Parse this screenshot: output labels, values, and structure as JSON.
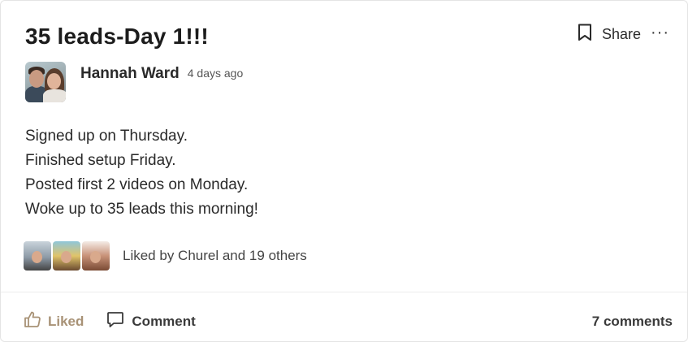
{
  "post": {
    "title": "35 leads-Day 1!!!",
    "author": "Hannah Ward",
    "time": "4 days ago",
    "body": [
      "Signed up on Thursday.",
      "Finished setup Friday.",
      "Posted first 2 videos on Monday.",
      "Woke up to 35 leads this morning!"
    ]
  },
  "actions": {
    "share_label": "Share",
    "more_label": "···"
  },
  "likes": {
    "text": "Liked by Churel and 19 others"
  },
  "footer": {
    "like_label": "Liked",
    "comment_label": "Comment",
    "comment_count": "7 comments"
  },
  "icons": {
    "bookmark": "bookmark-icon",
    "more": "more-icon",
    "thumbs_up": "thumbs-up-icon",
    "comment": "comment-icon"
  },
  "colors": {
    "liked_accent": "#a89276",
    "text": "#2a2a2a"
  }
}
